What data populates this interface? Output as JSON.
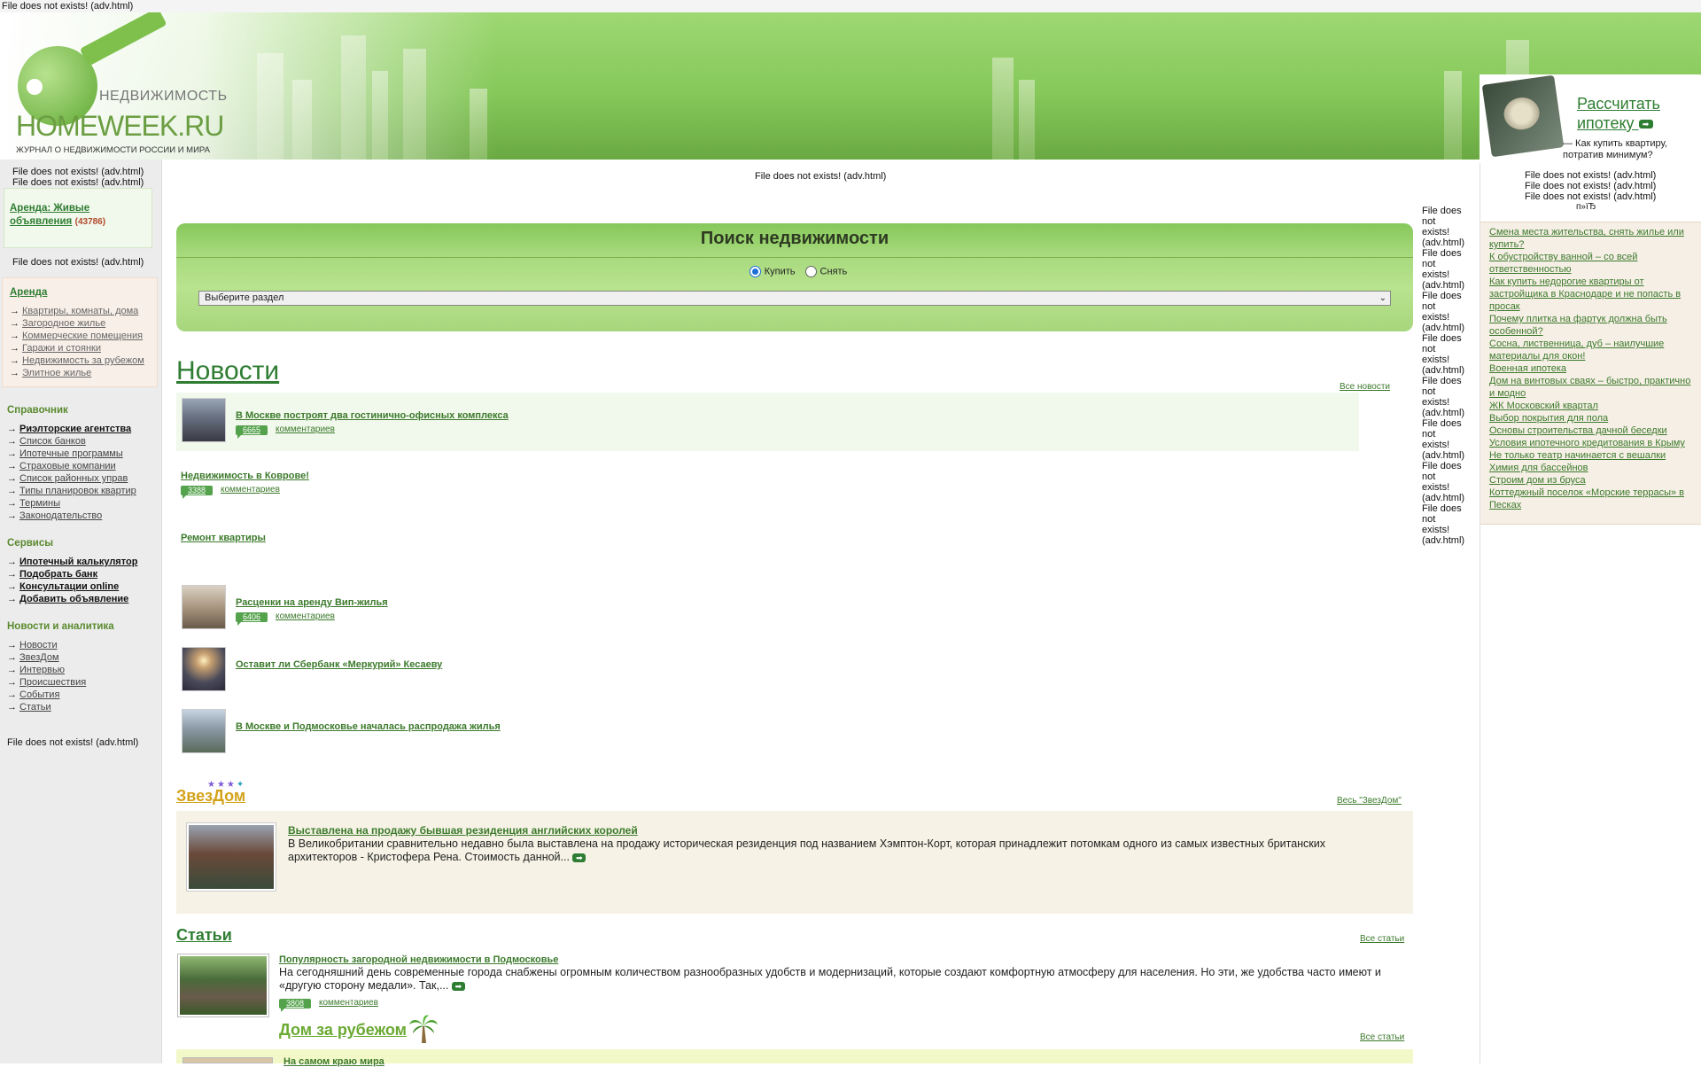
{
  "errors": {
    "msg": "File does not exists! (adv.html)",
    "wrapped": [
      "File does",
      "not",
      "exists!",
      "(adv.html)"
    ],
    "stray": "п»їЂ"
  },
  "header": {
    "logo_sub": "НЕДВИЖИМОСТЬ",
    "logo_main": "HOMEWEEK.RU",
    "logo_tag": "ЖУРНАЛ О НЕДВИЖИМОСТИ РОССИИ И МИРА",
    "calc_link": "Рассчитать ипотеку",
    "calc_sub": "— Как купить квартиру, потратив минимум?"
  },
  "left": {
    "rent_live": "Аренда: Живые объявления",
    "rent_live_count": "(43786)",
    "arenda": {
      "title": "Аренда",
      "items": [
        "Квартиры, комнаты, дома",
        "Загородное жилье",
        "Коммерческие помещения",
        "Гаражи и стоянки",
        "Недвижимость за рубежом",
        "Элитное жилье"
      ]
    },
    "spravochnik": {
      "title": "Справочник",
      "items": [
        "Риэлторские агентства",
        "Список банков",
        "Ипотечные программы",
        "Страховые компании",
        "Список районных управ",
        "Типы планировок квартир",
        "Термины",
        "Законодательство"
      ]
    },
    "services": {
      "title": "Сервисы",
      "items": [
        "Ипотечный калькулятор",
        "Подобрать банк",
        "Консультации online",
        "Добавить объявление"
      ]
    },
    "analytics": {
      "title": "Новости и аналитика",
      "items": [
        "Новости",
        "ЗвезДом",
        "Интервью",
        "Происшествия",
        "События",
        "Статьи"
      ]
    }
  },
  "search": {
    "title": "Поиск недвижимости",
    "radio_buy": "Купить",
    "radio_rent": "Снять",
    "select_value": "Выберите раздел"
  },
  "news": {
    "heading": "Новости",
    "all_link": "Все новости",
    "comments_label": "комментариев",
    "items": [
      {
        "title": "В Москве построят два гостинично-офисных комплекса",
        "count": "6665"
      },
      {
        "title": "Недвижимость в Коврове!",
        "count": "3388"
      },
      {
        "title": "Ремонт квартиры",
        "count": ""
      },
      {
        "title": "Расценки на аренду Вип-жилья",
        "count": "6406"
      },
      {
        "title": "Оставит ли Сбербанк «Меркурий» Кесаеву",
        "count": ""
      },
      {
        "title": "В Москве и Подмосковье началась распродажа жилья",
        "count": ""
      }
    ]
  },
  "zvezdom": {
    "heading": "ЗвезДом",
    "all_link": "Весь \"ЗвезДом\"",
    "title": "Выставлена на продажу бывшая резиденция английских королей",
    "text": "В Великобритании сравнительно недавно была выставлена на продажу историческая резиденция под названием Хэмптон-Корт, которая принадлежит потомкам одного из самых известных британских архитекторов - Кристофера Рена. Стоимость данной..."
  },
  "articles": {
    "heading": "Статьи",
    "all_link": "Все статьи",
    "title": "Популярность загородной недвижимости в Подмосковье",
    "text": "На сегодняшний день современные города снабжены огромным количеством разнообразных удобств и модернизаций, которые создают комфортную атмосферу для населения. Но эти, же удобства часто имеют и «другую сторону медали». Так,...",
    "count": "3808",
    "comments_label": "комментариев"
  },
  "abroad": {
    "heading": "Дом за рубежом",
    "all_link": "Все статьи",
    "title": "На самом краю мира"
  },
  "right": {
    "links": [
      "Смена места жительства, снять жилье или купить?",
      "К обустройству ванной – со всей ответственностью",
      "Как купить недорогие квартиры от застройщика в Краснодаре и не попасть в просак",
      "Почему плитка на фартук должна быть особенной?",
      "Сосна, лиственница, дуб – наилучшие материалы для окон!",
      "Военная ипотека",
      "Дом на винтовых сваях – быстро, практично и модно",
      "ЖК Московский квартал",
      "Выбор покрытия для пола",
      "Основы строительства дачной беседки",
      "Условия ипотечного кредитования в Крыму",
      "Не только театр начинается с вешалки",
      "Химия для бассейнов",
      "Строим дом из бруса",
      "Коттеджный поселок «Морские террасы» в Песках"
    ]
  }
}
